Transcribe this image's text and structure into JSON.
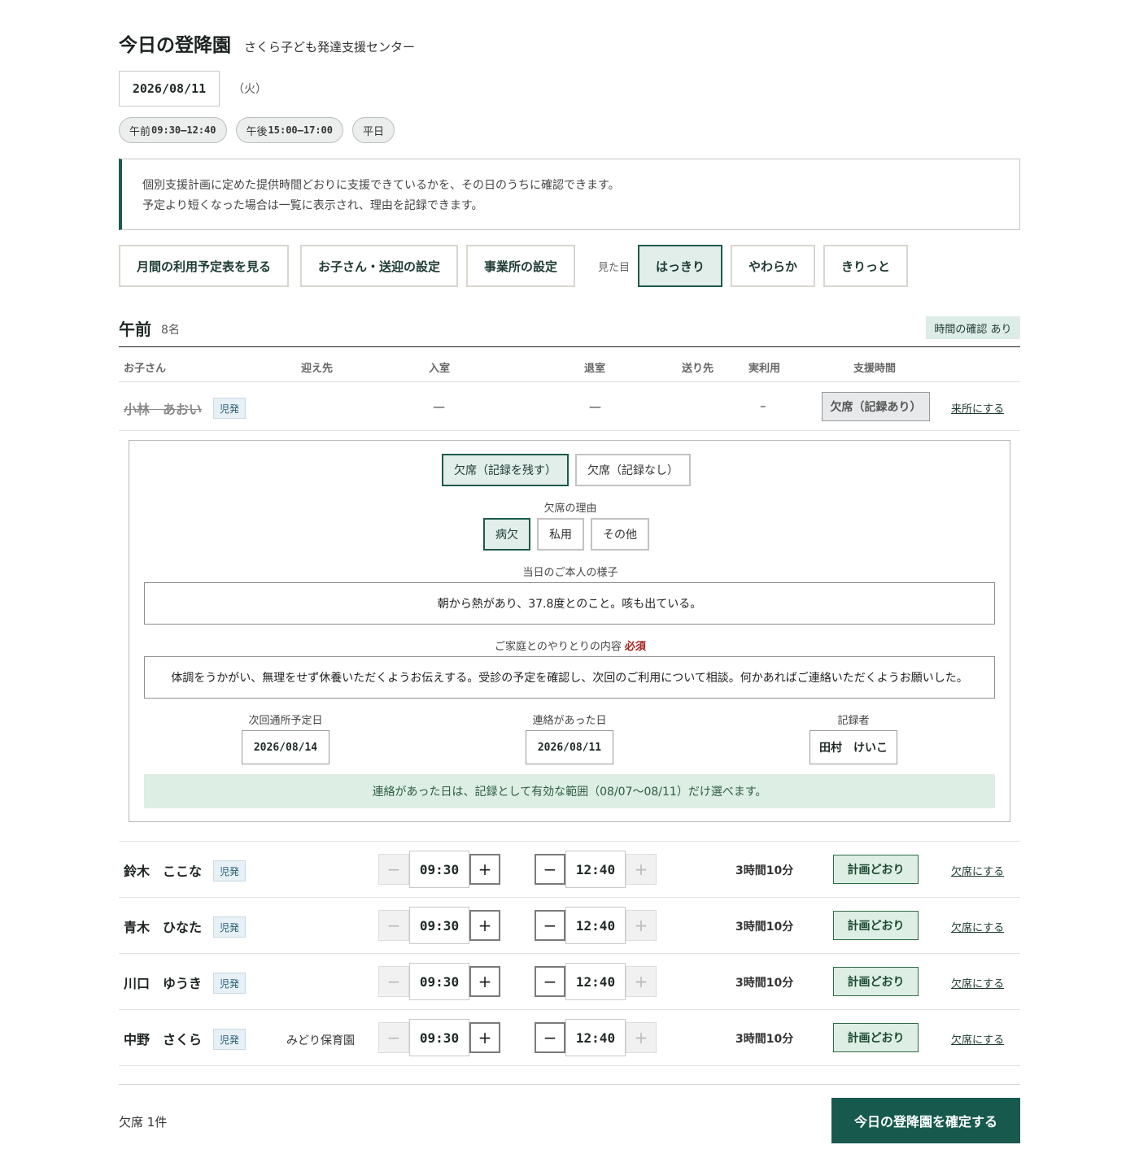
{
  "header": {
    "title": "今日の登降園",
    "facility": "さくら子ども発達支援センター"
  },
  "date": {
    "value": "2026/08/11",
    "weekday": "（火）"
  },
  "chips": {
    "am_label": "午前",
    "am_time": "09:30–12:40",
    "pm_label": "午後",
    "pm_time": "15:00–17:00",
    "day_type": "平日"
  },
  "notice": {
    "line1": "個別支援計画に定めた提供時間どおりに支援できているかを、その日のうちに確認できます。",
    "line2": "予定より短くなった場合は一覧に表示され、理由を記録できます。"
  },
  "toolbar": {
    "monthly": "月間の利用予定表を見る",
    "children": "お子さん・送迎の設定",
    "office": "事業所の設定",
    "view_label": "見た目",
    "themes": [
      "はっきり",
      "やわらか",
      "きりっと"
    ],
    "active_theme": "はっきり"
  },
  "section": {
    "title": "午前",
    "count": "8名",
    "check_badge": "時間の確認 あり"
  },
  "columns": {
    "child": "お子さん",
    "pickup": "迎え先",
    "checkin": "入室",
    "checkout": "退室",
    "dropoff": "送り先",
    "actual": "実利用",
    "support": "支援時間"
  },
  "absent_row": {
    "name": "小林　あおい",
    "tag": "児発",
    "checkin": "—",
    "checkout": "—",
    "actual": "–",
    "status": "欠席（記録あり）",
    "action": "来所にする"
  },
  "absence_detail": {
    "mode_options": [
      "欠席（記録を残す）",
      "欠席（記録なし）"
    ],
    "mode_selected": "欠席（記録を残す）",
    "reason_label": "欠席の理由",
    "reasons": [
      "病欠",
      "私用",
      "その他"
    ],
    "reason_selected": "病欠",
    "condition_label": "当日のご本人の様子",
    "condition": "朝から熱があり、37.8度とのこと。咳も出ている。",
    "family_label": "ご家庭とのやりとりの内容",
    "required": "必須",
    "family": "体調をうかがい、無理をせず休養いただくようお伝えする。受診の予定を確認し、次回のご利用について相談。何かあればご連絡いただくようお願いした。",
    "next_visit_label": "次回通所予定日",
    "next_visit": "2026/08/14",
    "contact_label": "連絡があった日",
    "contact": "2026/08/11",
    "recorder_label": "記録者",
    "recorder": "田村　けいこ",
    "hint": "連絡があった日は、記録として有効な範囲（08/07〜08/11）だけ選べます。"
  },
  "rows": [
    {
      "name": "鈴木　ここな",
      "tag": "児発",
      "pickup": "",
      "checkin": "09:30",
      "checkout": "12:40",
      "actual": "3時間10分",
      "status": "計画どおり",
      "action": "欠席にする"
    },
    {
      "name": "青木　ひなた",
      "tag": "児発",
      "pickup": "",
      "checkin": "09:30",
      "checkout": "12:40",
      "actual": "3時間10分",
      "status": "計画どおり",
      "action": "欠席にする"
    },
    {
      "name": "川口　ゆうき",
      "tag": "児発",
      "pickup": "",
      "checkin": "09:30",
      "checkout": "12:40",
      "actual": "3時間10分",
      "status": "計画どおり",
      "action": "欠席にする"
    },
    {
      "name": "中野　さくら",
      "tag": "児発",
      "pickup": "みどり保育園",
      "checkin": "09:30",
      "checkout": "12:40",
      "actual": "3時間10分",
      "status": "計画どおり",
      "action": "欠席にする"
    }
  ],
  "stepper": {
    "minus": "−",
    "plus": "+"
  },
  "footer": {
    "absent_count": "欠席 1件",
    "confirm": "今日の登降園を確定する"
  },
  "colors": {
    "accent": "#175a4d",
    "plan_bg": "#ddeee4",
    "check_badge_bg": "#deece8"
  }
}
